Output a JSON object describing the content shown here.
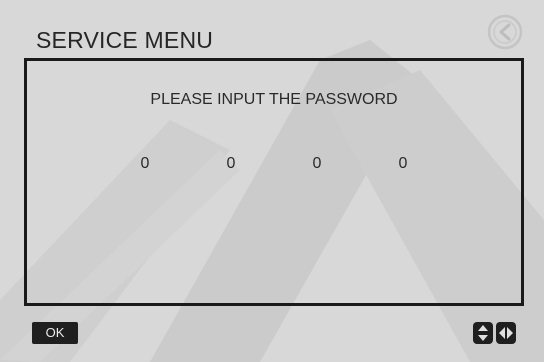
{
  "title": "SERVICE MENU",
  "prompt": "PLEASE INPUT THE PASSWORD",
  "digits": [
    "0",
    "0",
    "0",
    "0"
  ],
  "ok_label": "OK",
  "icons": {
    "back": "back-arrow-icon",
    "updown": "up-down-arrows-icon",
    "leftright": "left-right-arrows-icon"
  },
  "colors": {
    "background": "#d8d8d8",
    "text": "#262626",
    "ok_button": "#1f1f1f"
  }
}
